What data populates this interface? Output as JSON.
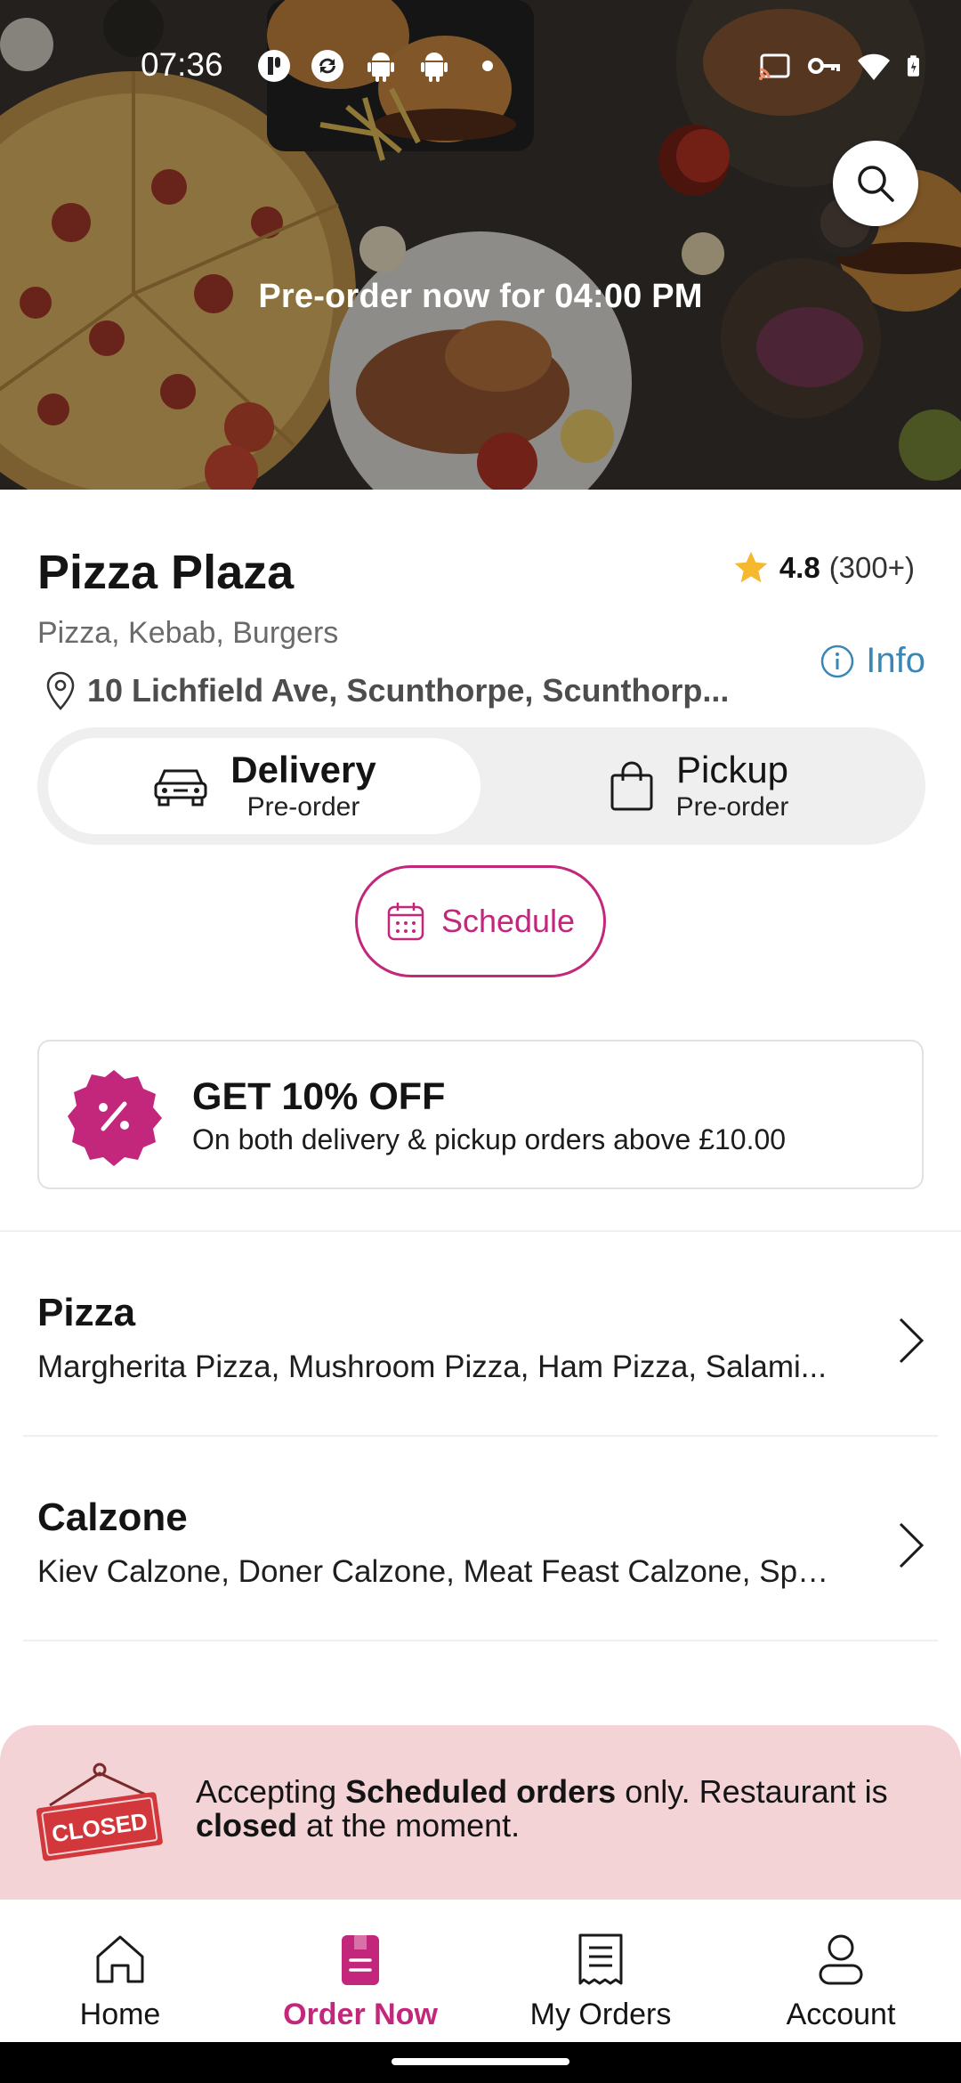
{
  "status_bar": {
    "time": "07:36",
    "left_icons": [
      "app-notification-icon",
      "sync-icon",
      "android-icon",
      "android-icon",
      "dot-icon"
    ],
    "right_icons": [
      "cast-icon",
      "vpn-key-icon",
      "wifi-icon",
      "battery-charging-icon"
    ]
  },
  "hero": {
    "title": "Pre-order now for 04:00 PM",
    "search_icon": "search-icon"
  },
  "restaurant": {
    "name": "Pizza Plaza",
    "rating": "4.8",
    "rating_count": "(300+)",
    "cuisines": "Pizza, Kebab, Burgers",
    "info_label": "Info",
    "address": "10 Lichfield Ave, Scunthorpe, Scunthorp..."
  },
  "order_mode": {
    "options": [
      {
        "label": "Delivery",
        "sub": "Pre-order",
        "icon": "car-icon",
        "selected": true
      },
      {
        "label": "Pickup",
        "sub": "Pre-order",
        "icon": "shopping-bag-icon",
        "selected": false
      }
    ],
    "schedule_label": "Schedule"
  },
  "promo": {
    "title": "GET 10% OFF",
    "subtitle": "On both delivery & pickup orders above £10.00"
  },
  "categories": [
    {
      "title": "Pizza",
      "items": "Margherita Pizza, Mushroom Pizza, Ham Pizza, Salami..."
    },
    {
      "title": "Calzone",
      "items": "Kiev Calzone, Doner Calzone, Meat Feast Calzone, Spe..."
    }
  ],
  "closed_banner": {
    "sign_text": "CLOSED",
    "text_before": "Accepting ",
    "text_bold1": "Scheduled orders",
    "text_middle": " only. Restaurant is ",
    "text_bold2": "closed",
    "text_after": " at the moment."
  },
  "bottom_nav": {
    "items": [
      {
        "label": "Home",
        "icon": "home-icon",
        "active": false
      },
      {
        "label": "Order Now",
        "icon": "order-book-icon",
        "active": true
      },
      {
        "label": "My Orders",
        "icon": "receipt-icon",
        "active": false
      },
      {
        "label": "Account",
        "icon": "person-icon",
        "active": false
      }
    ]
  },
  "colors": {
    "accent": "#c2277c",
    "info_blue": "#3a86b4",
    "star": "#f5b82e",
    "closed_banner_bg": "#f4d3d7",
    "closed_sign": "#d2383b"
  }
}
